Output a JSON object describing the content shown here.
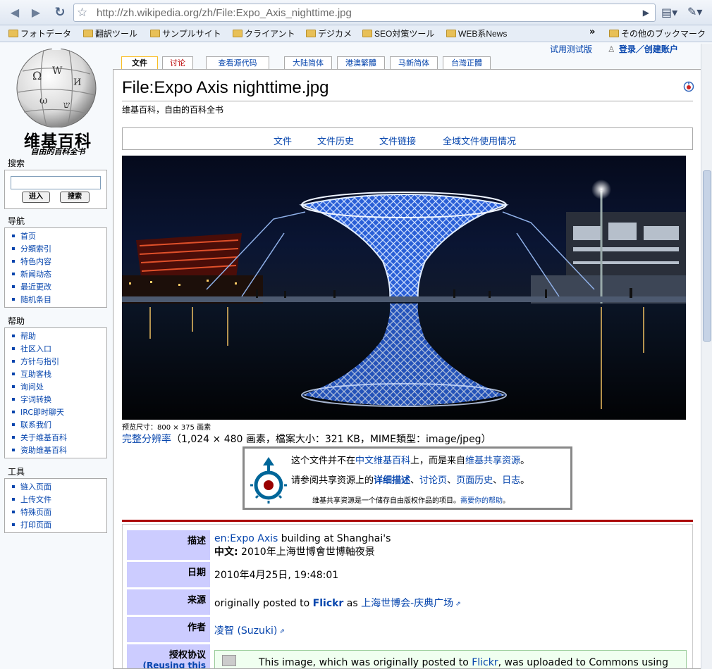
{
  "browser": {
    "url": "http://zh.wikipedia.org/zh/File:Expo_Axis_nighttime.jpg",
    "bookmarks": [
      "フォトデータ",
      "翻訳ツール",
      "サンプルサイト",
      "クライアント",
      "デジカメ",
      "SEO対策ツール",
      "WEB系News"
    ],
    "chevron": "»",
    "other_bookmarks": "その他のブックマーク"
  },
  "top_links": {
    "beta": "试用测试版",
    "login": "登录／创建账户"
  },
  "logo": {
    "name": "维基百科",
    "tagline": "自由的百科全书"
  },
  "tabs": [
    "文件",
    "讨论",
    "查看源代码",
    "大陆简体",
    "港澳繁體",
    "马新简体",
    "台灣正體"
  ],
  "sidebar": {
    "search": {
      "title": "搜索",
      "go": "进入",
      "search": "搜索"
    },
    "nav": {
      "title": "导航",
      "items": [
        "首页",
        "分類索引",
        "特色内容",
        "新闻动态",
        "最近更改",
        "随机条目"
      ]
    },
    "help": {
      "title": "帮助",
      "items": [
        "帮助",
        "社区入口",
        "方针与指引",
        "互助客栈",
        "询问处",
        "字词转换",
        "IRC即时聊天",
        "联系我们",
        "关于维基百科",
        "资助维基百科"
      ]
    },
    "tools": {
      "title": "工具",
      "items": [
        "链入页面",
        "上传文件",
        "特殊页面",
        "打印页面"
      ]
    }
  },
  "content": {
    "title": "File:Expo Axis nighttime.jpg",
    "subtitle": "维基百科，自由的百科全书",
    "file_nav": [
      "文件",
      "文件历史",
      "文件链接",
      "全域文件使用情况"
    ],
    "preview_size": "预览尺寸：800 × 375 画素",
    "full_res_link": "完整分辨率",
    "full_res_info": "（1,024 × 480 画素，檔案大小：321 KB，MIME類型：image/jpeg）",
    "commons": {
      "line1_a": "这个文件并不在",
      "line1_link1": "中文维基百科",
      "line1_b": "上，而是来自",
      "line1_link2": "维基共享资源",
      "line1_c": "。",
      "line2_a": "请参阅共享资源上的",
      "line2_link1": "详细描述",
      "line2_sep1": "、",
      "line2_link2": "讨论页",
      "line2_sep2": "、",
      "line2_link3": "页面历史",
      "line2_sep3": "、",
      "line2_link4": "日志",
      "line2_c": "。",
      "line3_a": "维基共享资源是一个储存自由版权作品的项目。",
      "line3_link": "需要你的帮助",
      "line3_c": "。"
    },
    "info": {
      "desc_label": "描述",
      "desc_link": "en:Expo Axis",
      "desc_text": " building at Shanghai's",
      "desc_zh_label": "中文:",
      "desc_zh_text": " 2010年上海世博會世博軸夜景",
      "date_label": "日期",
      "date_value": "2010年4月25日, 19:48:01",
      "source_label": "来源",
      "source_text": "originally posted to ",
      "source_flickr": "Flickr",
      "source_as": " as ",
      "source_link": "上海世博会-庆典广场",
      "author_label": "作者",
      "author_link": "凌智 (Suzuki)",
      "license_label": "授权协议",
      "license_sub": "(Reusing this",
      "license_text_a": "This image, which was originally posted to ",
      "license_flickr": "Flickr",
      "license_text_b": ", was uploaded to Commons using"
    }
  },
  "colors": {
    "link": "#0645ad",
    "accent_red": "#aa0000",
    "label_bg": "#ccccff"
  }
}
